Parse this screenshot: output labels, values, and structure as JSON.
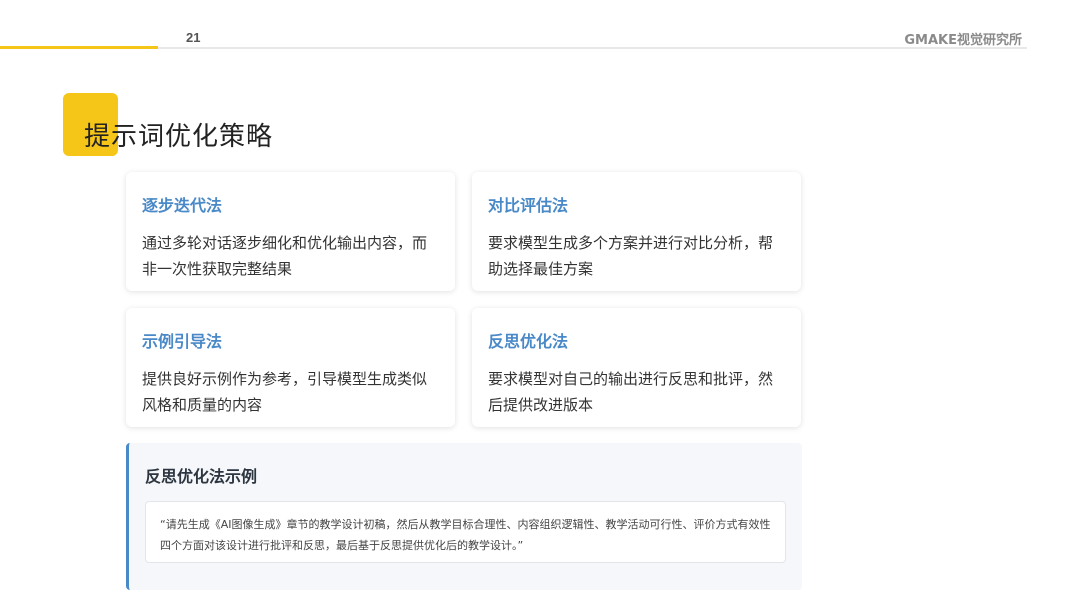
{
  "header": {
    "page_number": "21",
    "brand": "GMAKE视觉研究所"
  },
  "title": "提示词优化策略",
  "cards": [
    {
      "title": "逐步迭代法",
      "desc": "通过多轮对话逐步细化和优化输出内容，而非一次性获取完整结果"
    },
    {
      "title": "对比评估法",
      "desc": "要求模型生成多个方案并进行对比分析，帮助选择最佳方案"
    },
    {
      "title": "示例引导法",
      "desc": "提供良好示例作为参考，引导模型生成类似风格和质量的内容"
    },
    {
      "title": "反思优化法",
      "desc": "要求模型对自己的输出进行反思和批评，然后提供改进版本"
    }
  ],
  "example": {
    "title": "反思优化法示例",
    "quote": "“请先生成《AI图像生成》章节的教学设计初稿，然后从教学目标合理性、内容组织逻辑性、教学活动可行性、评价方式有效性四个方面对该设计进行批评和反思，最后基于反思提供优化后的教学设计。”"
  },
  "colors": {
    "accent_yellow": "#f5c518",
    "accent_blue": "#4a89c8"
  }
}
